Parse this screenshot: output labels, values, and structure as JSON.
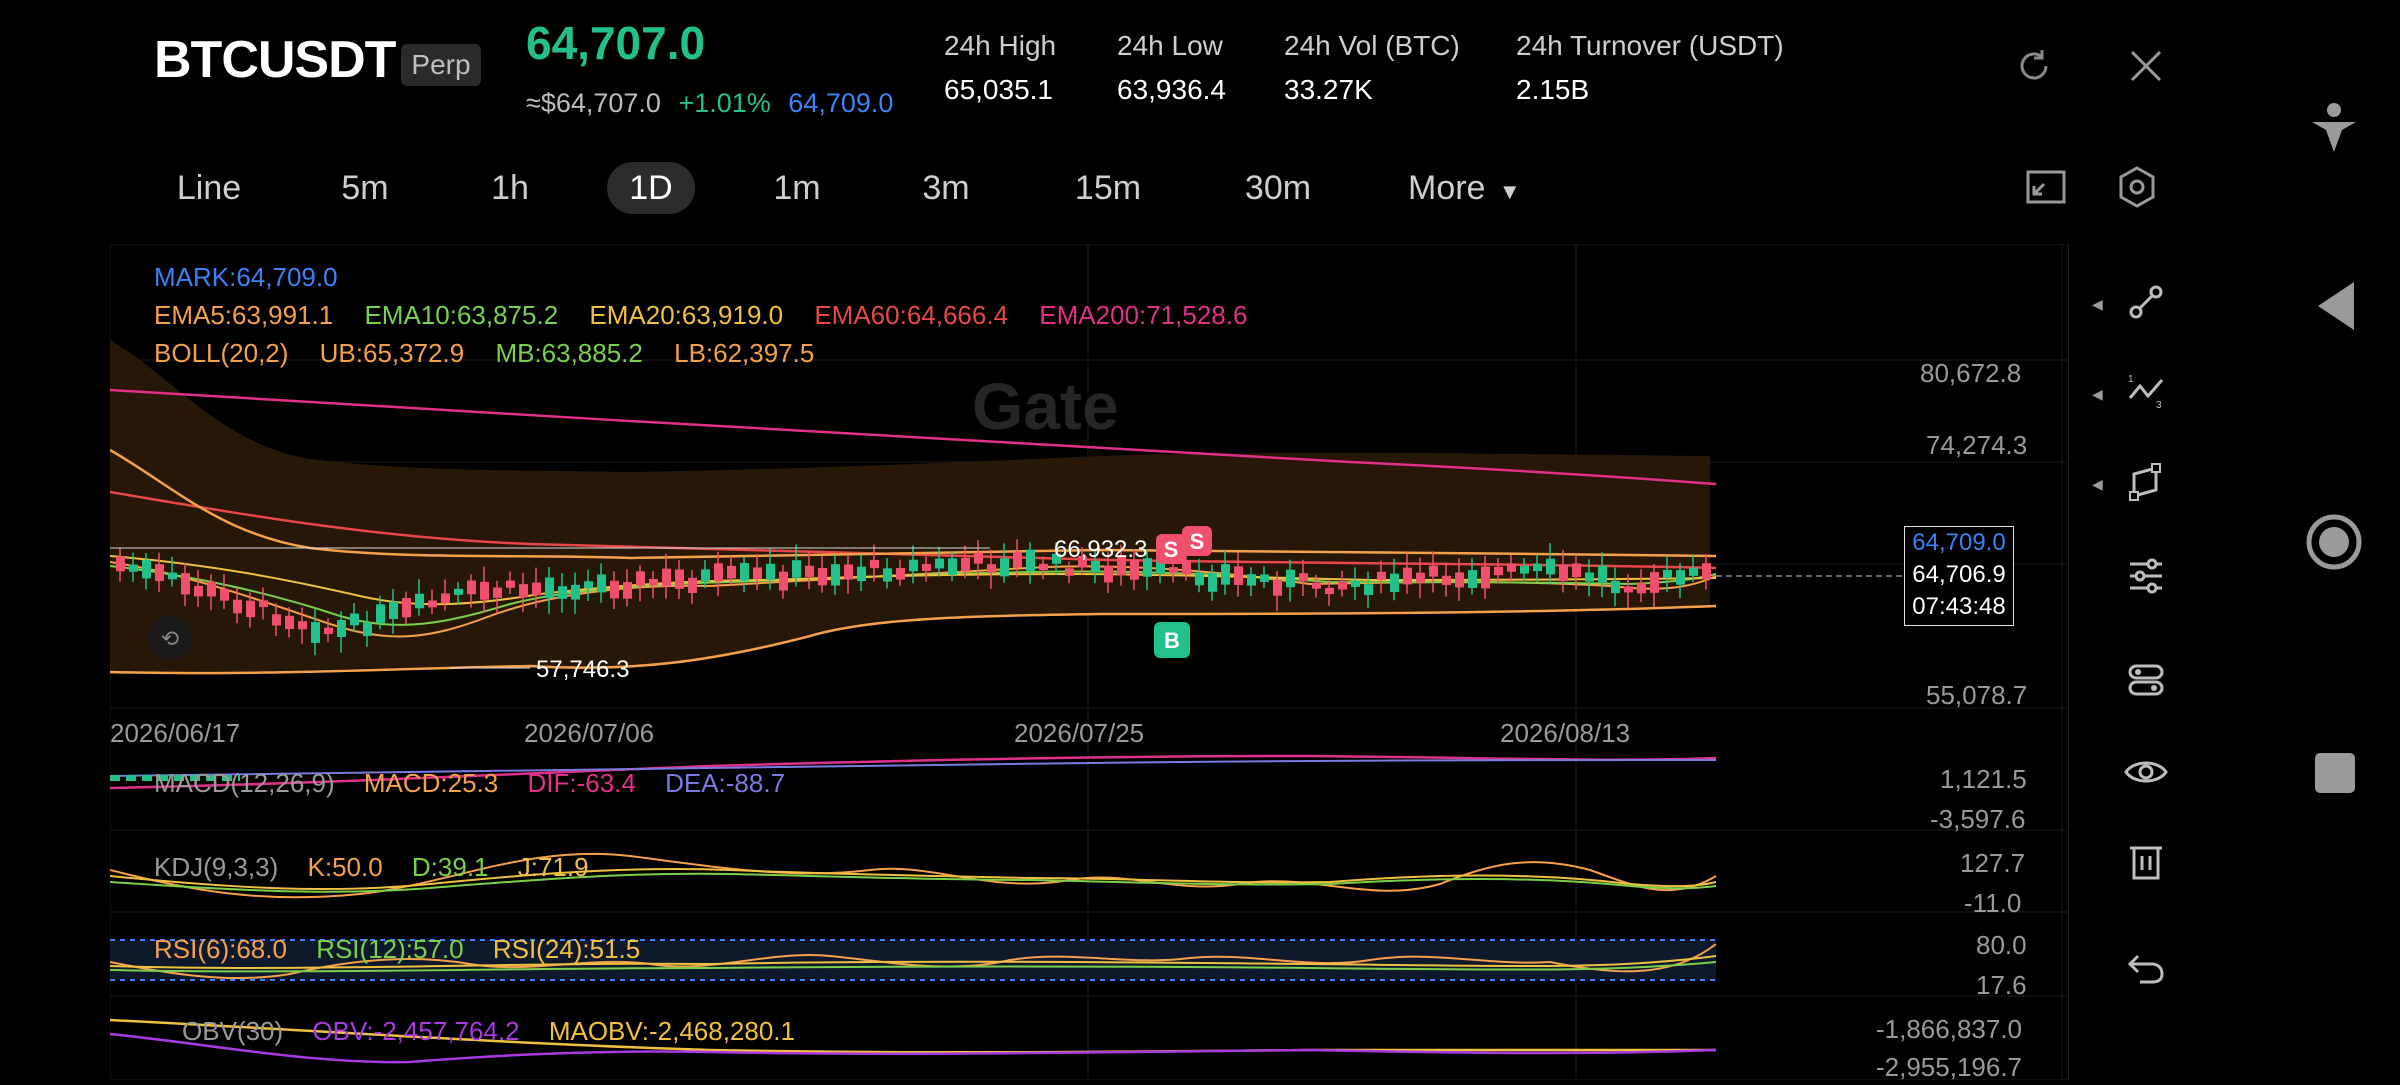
{
  "header": {
    "symbol": "BTCUSDT",
    "badge": "Perp",
    "last_price": "64,707.0",
    "usd_price": "≈$64,707.0",
    "change": "+1.01%",
    "mark_price": "64,709.0",
    "stats": [
      {
        "label": "24h  High",
        "value": "65,035.1"
      },
      {
        "label": "24h  Low",
        "value": "63,936.4"
      },
      {
        "label": "24h  Vol (BTC)",
        "value": "33.27K"
      },
      {
        "label": "24h  Turnover (USDT)",
        "value": "2.15B"
      }
    ],
    "icons": [
      "refresh-icon",
      "close-icon"
    ]
  },
  "timeframes": [
    "Line",
    "5m",
    "1h",
    "1D",
    "1m",
    "3m",
    "15m",
    "30m",
    "More"
  ],
  "active_timeframe": "1D",
  "chart": {
    "watermark": "Gate",
    "legend_mark": "MARK:64,709.0",
    "ema": [
      "EMA5:63,991.1",
      "EMA10:63,875.2",
      "EMA20:63,919.0",
      "EMA60:64,666.4",
      "EMA200:71,528.6"
    ],
    "boll": [
      "BOLL(20,2)",
      "UB:65,372.9",
      "MB:63,885.2",
      "LB:62,397.5"
    ],
    "price_axis": [
      "80,672.8",
      "74,274.3",
      "55,078.7"
    ],
    "price_tag": {
      "mark": "64,709.0",
      "last": "64,706.9",
      "countdown": "07:43:48"
    },
    "high_label": "66,932.3",
    "low_label": "57,746.3",
    "dates": [
      "2026/06/17",
      "2026/07/06",
      "2026/07/25",
      "2026/08/13"
    ],
    "markers": {
      "sell": "S",
      "buy": "B"
    },
    "macd": {
      "title": "MACD(12,26,9)",
      "macd": "MACD:25.3",
      "dif": "DIF:-63.4",
      "dea": "DEA:-88.7",
      "axis": [
        "1,121.5",
        "-3,597.6"
      ]
    },
    "kdj": {
      "title": "KDJ(9,3,3)",
      "k": "K:50.0",
      "d": "D:39.1",
      "j": "J:71.9",
      "axis": [
        "127.7",
        "-11.0"
      ]
    },
    "rsi": {
      "r6": "RSI(6):68.0",
      "r12": "RSI(12):57.0",
      "r24": "RSI(24):51.5",
      "axis": [
        "80.0",
        "17.6"
      ]
    },
    "obv": {
      "title": "OBV(30)",
      "obv": "OBV:-2,457,764.2",
      "maobv": "MAOBV:-2,468,280.1",
      "axis": [
        "-1,866,837.0",
        "-2,955,196.7"
      ]
    }
  },
  "colors": {
    "up": "#22c08a",
    "down": "#f0506e",
    "mark": "#3b82f6",
    "ema5": "#f5a04a",
    "ema10": "#7ad04a",
    "ema20": "#f0c040",
    "ema60": "#e84848",
    "ema200": "#e0308a"
  }
}
